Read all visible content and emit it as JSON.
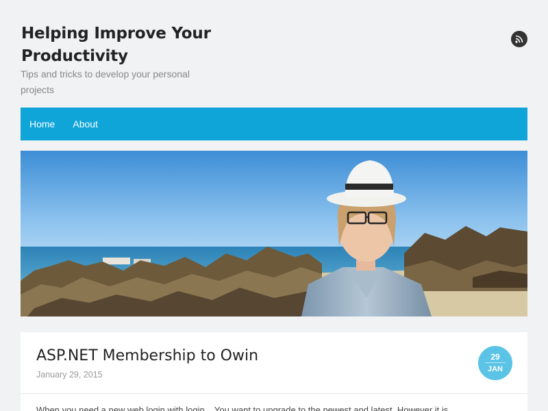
{
  "site": {
    "title": "Helping Improve Your Productivity",
    "tagline": "Tips and tricks to develop your personal projects"
  },
  "header": {
    "rss_icon": "rss-icon"
  },
  "nav": {
    "items": [
      {
        "label": "Home"
      },
      {
        "label": "About"
      }
    ]
  },
  "post": {
    "title": "ASP.NET Membership to Owin",
    "date": "January 29, 2015",
    "badge": {
      "day": "29",
      "month": "JAN"
    },
    "excerpt": "When you need a new web login with login... You want to upgrade to the newest and latest. However it is"
  },
  "colors": {
    "background": "#f0f2f3",
    "nav": "#0fa5d8",
    "badge": "#5bc3e6",
    "rss": "#333333"
  }
}
